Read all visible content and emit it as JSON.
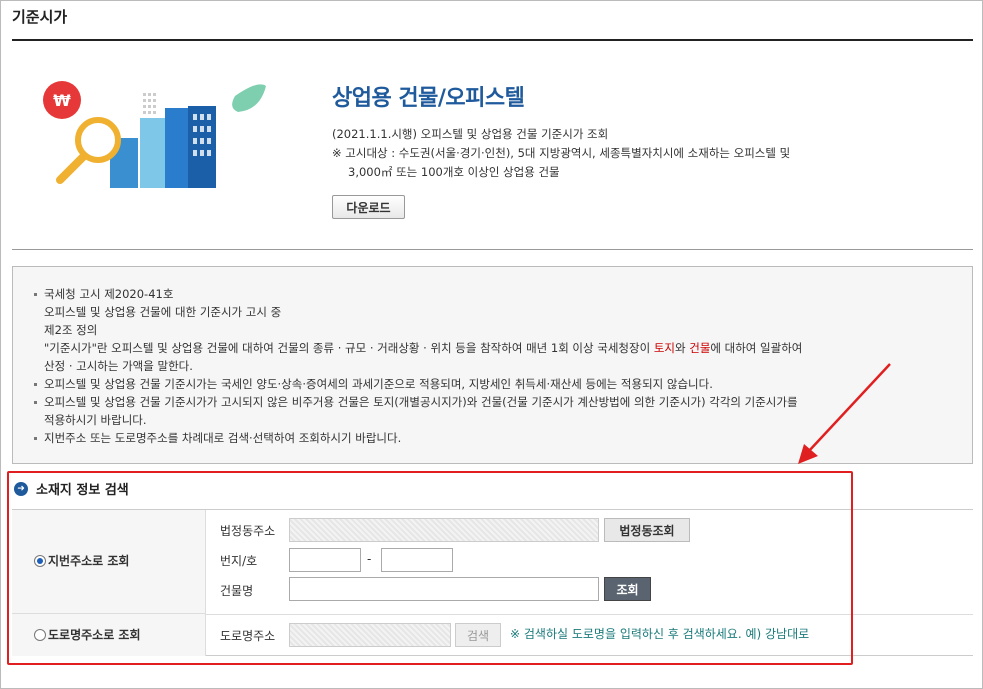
{
  "page": {
    "title": "기준시가"
  },
  "product": {
    "title": "상업용 건물/오피스텔",
    "desc_line1": "(2021.1.1.시행) 오피스텔 및 상업용 건물 기준시가 조회",
    "desc_line2": "※ 고시대상 : 수도권(서울·경기·인천), 5대 지방광역시, 세종특별자치시에 소재하는 오피스텔 및",
    "desc_line3": "3,000㎡ 또는 100개호 이상인 상업용 건물",
    "download_label": "다운로드"
  },
  "info": {
    "line1": "국세청 고시 제2020-41호",
    "line2": "오피스텔 및 상업용 건물에 대한 기준시가 고시 중",
    "line3": "제2조 정의",
    "line4a": "\"기준시가\"란 오피스텔 및 상업용 건물에 대하여 건물의 종류 · 규모 · 거래상황 · 위치 등을 참작하여 매년 1회 이상 국세청장이 ",
    "line4_red1": "토지",
    "line4_mid": "와 ",
    "line4_red2": "건물",
    "line4b": "에 대하여 일괄하여",
    "line5": "산정 · 고시하는 가액을 말한다.",
    "line6": "오피스텔 및 상업용 건물 기준시가는 국세인 양도·상속·증여세의 과세기준으로 적용되며, 지방세인 취득세·재산세 등에는 적용되지 않습니다.",
    "line7": "오피스텔 및 상업용 건물 기준시가가 고시되지 않은 비주거용 건물은 토지(개별공시지가)와 건물(건물 기준시가 계산방법에 의한 기준시가) 각각의 기준시가를",
    "line8": "적용하시기 바랍니다.",
    "line9": "지번주소 또는 도로명주소를 차례대로 검색·선택하여 조회하시기 바랍니다."
  },
  "search": {
    "section_title": "소재지 정보 검색",
    "radio_jibun": "지번주소로 조회",
    "radio_road": "도로명주소로 조회",
    "label_beopjeongdong": "법정동주소",
    "btn_beopjeongdong": "법정동조회",
    "label_bunji": "번지/호",
    "dash": "-",
    "label_building": "건물명",
    "btn_lookup": "조회",
    "label_road": "도로명주소",
    "btn_search": "검색",
    "hint": "※ 검색하실 도로명을 입력하신 후 검색하세요. 예) 강남대로"
  },
  "colors": {
    "accent": "#1f5a9c",
    "annotation": "#e02020",
    "hint": "#1a7a7a"
  }
}
